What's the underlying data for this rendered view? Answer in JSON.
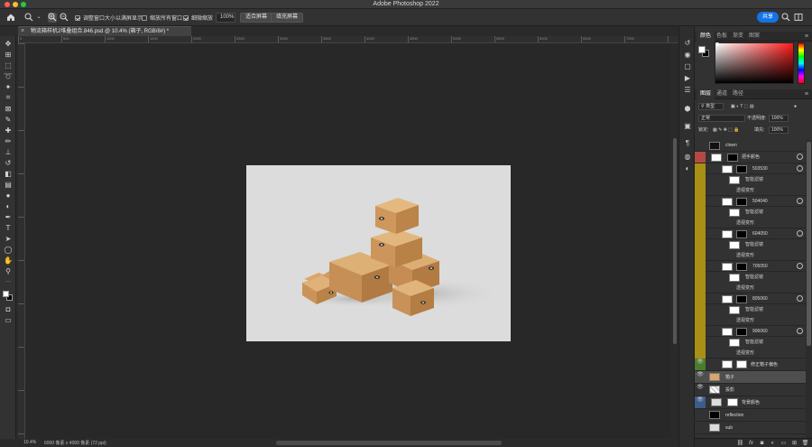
{
  "app": {
    "title": "Adobe Photoshop 2022"
  },
  "options_bar": {
    "resize_windows_label": "调整窗口大小以满屏显示",
    "resize_windows_checked": true,
    "zoom_all_label": "缩放所有窗口",
    "zoom_all_checked": false,
    "scrubby_zoom_label": "细微缩放",
    "scrubby_zoom_checked": true,
    "zoom_value": "100%",
    "fit_screen_label": "适合屏幕",
    "fill_screen_label": "填充屏幕",
    "share_label": "共享"
  },
  "document": {
    "tab_title": "物流箱样机2堆叠组合.846.psd @ 10.4% (箱子, RGB/8#) *",
    "close_glyph": "×"
  },
  "ruler_ticks": [
    "0",
    "500",
    "1000",
    "1500",
    "2000",
    "2500",
    "3000",
    "3500",
    "4000",
    "4500",
    "5000",
    "5500",
    "6000",
    "6500",
    "7000"
  ],
  "status": {
    "zoom": "10.4%",
    "doc_size": "6000 像素 x 4000 像素 (72 ppi)"
  },
  "color_panel": {
    "tabs": [
      "颜色",
      "色板",
      "渐变",
      "图案"
    ],
    "active_tab": 0,
    "foreground": "#ffffff",
    "background": "#000000"
  },
  "layers_panel": {
    "tabs": [
      "图层",
      "通道",
      "路径"
    ],
    "active_tab": 0,
    "filter_kind": "类型",
    "blend_mode": "正常",
    "opacity_label": "不透明度:",
    "opacity": "100%",
    "lock_label": "锁定:",
    "fill_label": "填充:",
    "fill": "100%",
    "layers": [
      {
        "name": "clown",
        "kind": "group",
        "color": "none"
      },
      {
        "name": "把手颜色",
        "kind": "solid",
        "color": "red"
      },
      {
        "name": "503530",
        "kind": "smart",
        "color": "yellow",
        "sub1": "智能滤镜",
        "sub2": "透视变形"
      },
      {
        "name": "504040",
        "kind": "smart",
        "color": "yellow",
        "sub1": "智能滤镜",
        "sub2": "透视变形"
      },
      {
        "name": "604050",
        "kind": "smart",
        "color": "yellow",
        "sub1": "智能滤镜",
        "sub2": "透视变形"
      },
      {
        "name": "705050",
        "kind": "smart",
        "color": "yellow",
        "sub1": "智能滤镜",
        "sub2": "透视变形"
      },
      {
        "name": "805060",
        "kind": "smart",
        "color": "yellow",
        "sub1": "智能滤镜",
        "sub2": "透视变形"
      },
      {
        "name": "906060",
        "kind": "smart",
        "color": "yellow",
        "sub1": "智能滤镜",
        "sub2": "透视变形"
      },
      {
        "name": "修正箱子偏色",
        "kind": "adjust",
        "color": "green"
      },
      {
        "name": "箱子",
        "kind": "image",
        "color": "none"
      },
      {
        "name": "投影",
        "kind": "image",
        "color": "none"
      },
      {
        "name": "背景颜色",
        "kind": "solid",
        "color": "blue"
      },
      {
        "name": "reflection",
        "kind": "image",
        "color": "none"
      },
      {
        "name": "sub",
        "kind": "image",
        "color": "none"
      }
    ]
  }
}
